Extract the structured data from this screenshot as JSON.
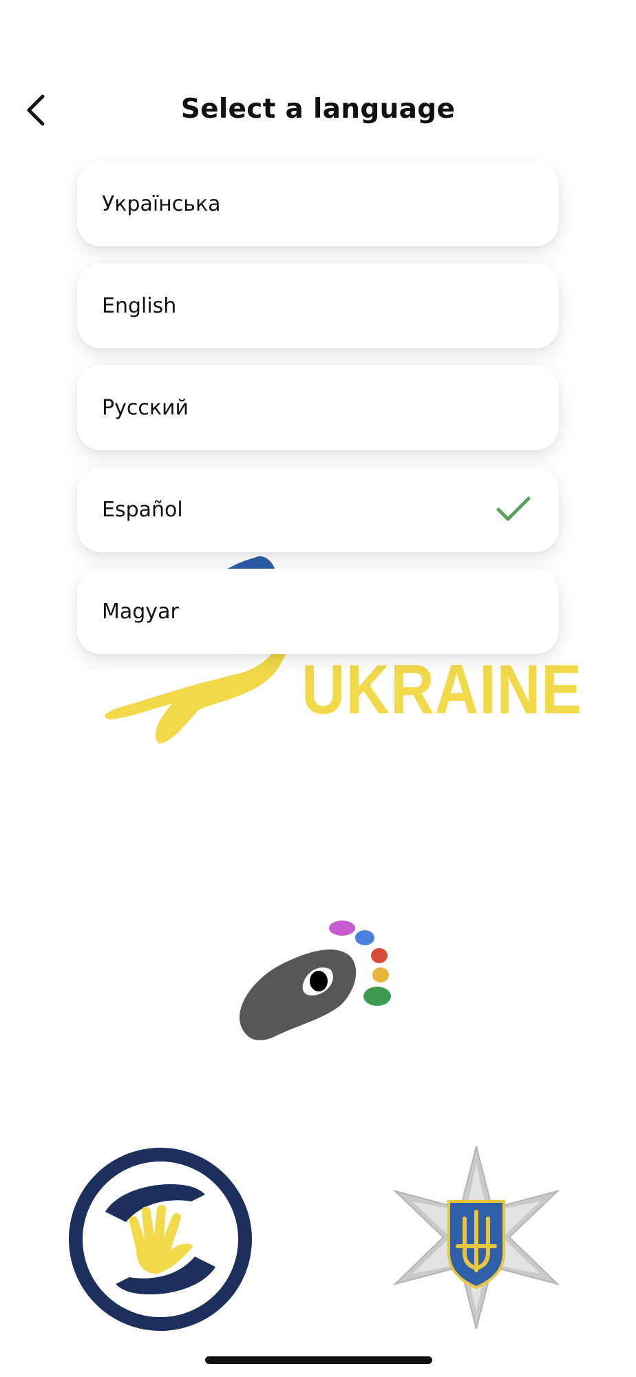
{
  "header": {
    "title": "Select a language",
    "back_icon": "chevron-left-icon"
  },
  "languages": [
    {
      "label": "Українська",
      "selected": false
    },
    {
      "label": "English",
      "selected": false
    },
    {
      "label": "Русский",
      "selected": false
    },
    {
      "label": "Español",
      "selected": true
    },
    {
      "label": "Magyar",
      "selected": false
    }
  ],
  "background": {
    "ukraine_text": "UKRAINE"
  },
  "colors": {
    "check": "#5aa35a",
    "ukraine_yellow": "#f2d94a",
    "ukraine_blue": "#2f5fa8",
    "navy": "#1d2f5c"
  }
}
